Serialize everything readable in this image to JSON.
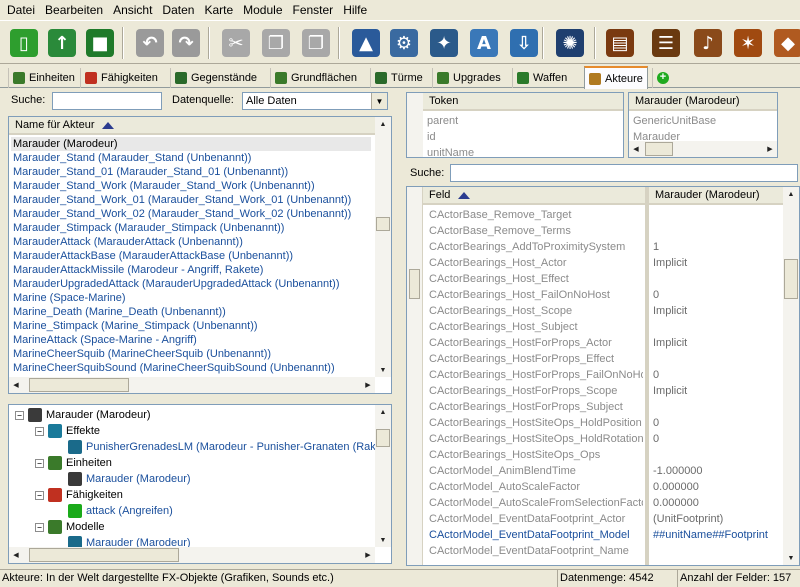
{
  "menu": [
    "Datei",
    "Bearbeiten",
    "Ansicht",
    "Daten",
    "Karte",
    "Module",
    "Fenster",
    "Hilfe"
  ],
  "toolbar": [
    {
      "name": "new-icon",
      "color": "#2e9e2e",
      "glyph": "▯"
    },
    {
      "name": "open-icon",
      "color": "#2a8a3a",
      "glyph": "↑"
    },
    {
      "name": "save-icon",
      "color": "#1f7a2a",
      "glyph": "■"
    },
    {
      "name": "undo-icon",
      "color": "#9a9a9a",
      "glyph": "↶"
    },
    {
      "name": "redo-icon",
      "color": "#9a9a9a",
      "glyph": "↷"
    },
    {
      "name": "cut-icon",
      "color": "#a8a8a8",
      "glyph": "✂"
    },
    {
      "name": "copy-icon",
      "color": "#a8a8a8",
      "glyph": "❐"
    },
    {
      "name": "paste-icon",
      "color": "#a8a8a8",
      "glyph": "❐"
    },
    {
      "name": "terrain-module-icon",
      "color": "#2a5a9a",
      "glyph": "▲"
    },
    {
      "name": "trigger-module-icon",
      "color": "#3a6aa0",
      "glyph": "⚙"
    },
    {
      "name": "data-module-icon",
      "color": "#2b5a8a",
      "glyph": "✦"
    },
    {
      "name": "text-module-icon",
      "color": "#3a78b8",
      "glyph": "A"
    },
    {
      "name": "import-module-icon",
      "color": "#2f6fb0",
      "glyph": "⇩"
    },
    {
      "name": "ai-module-icon",
      "color": "#1f3f6f",
      "glyph": "✺"
    },
    {
      "name": "cutscene-module-icon",
      "color": "#7a3a10",
      "glyph": "▤"
    },
    {
      "name": "list-module-icon",
      "color": "#6a3a10",
      "glyph": "☰"
    },
    {
      "name": "audio-module-icon",
      "color": "#8a4a1a",
      "glyph": "♪"
    },
    {
      "name": "unit-module-icon",
      "color": "#a04a10",
      "glyph": "✶"
    },
    {
      "name": "tech-module-icon",
      "color": "#b05a20",
      "glyph": "◆"
    }
  ],
  "tabs": [
    {
      "label": "Einheiten",
      "icon": "unit-tab-icon",
      "color": "#3a7a2a"
    },
    {
      "label": "Fähigkeiten",
      "icon": "ability-tab-icon",
      "color": "#c03020"
    },
    {
      "label": "Gegenstände",
      "icon": "item-tab-icon",
      "color": "#2a6a2a"
    },
    {
      "label": "Grundflächen",
      "icon": "footprint-tab-icon",
      "color": "#3a7a2a"
    },
    {
      "label": "Türme",
      "icon": "turret-tab-icon",
      "color": "#2a6a2a"
    },
    {
      "label": "Upgrades",
      "icon": "upgrade-tab-icon",
      "color": "#3a7a2a"
    },
    {
      "label": "Waffen",
      "icon": "weapon-tab-icon",
      "color": "#2a7a2a"
    },
    {
      "label": "Akteure",
      "icon": "actor-tab-icon",
      "color": "#b07a20"
    },
    {
      "label": "",
      "icon": "add-tab-icon",
      "color": "#1faa1f"
    }
  ],
  "left": {
    "search_label": "Suche:",
    "search_value": "",
    "source_label": "Datenquelle:",
    "source_value": "Alle Daten",
    "list_header": "Name für Akteur",
    "items": [
      "Marauder (Marodeur)",
      "Marauder_Stand (Marauder_Stand (Unbenannt))",
      "Marauder_Stand_01 (Marauder_Stand_01 (Unbenannt))",
      "Marauder_Stand_Work (Marauder_Stand_Work (Unbenannt))",
      "Marauder_Stand_Work_01 (Marauder_Stand_Work_01 (Unbenannt))",
      "Marauder_Stand_Work_02 (Marauder_Stand_Work_02 (Unbenannt))",
      "Marauder_Stimpack (Marauder_Stimpack (Unbenannt))",
      "MarauderAttack (MarauderAttack (Unbenannt))",
      "MarauderAttackBase (MarauderAttackBase (Unbenannt))",
      "MarauderAttackMissile (Marodeur - Angriff, Rakete)",
      "MarauderUpgradedAttack (MarauderUpgradedAttack (Unbenannt))",
      "Marine (Space-Marine)",
      "Marine_Death (Marine_Death (Unbenannt))",
      "Marine_Stimpack (Marine_Stimpack (Unbenannt))",
      "MarineAttack (Space-Marine - Angriff)",
      "MarineCheerSquib (MarineCheerSquib (Unbenannt))",
      "MarineCheerSquibSound (MarineCheerSquibSound (Unbenannt))"
    ],
    "tree": [
      {
        "level": 0,
        "exp": "−",
        "icon": "marauder-icon",
        "color": "#3a3a3a",
        "text": "Marauder (Marodeur)",
        "blue": false
      },
      {
        "level": 1,
        "exp": "−",
        "icon": "effects-folder-icon",
        "color": "#1a7a9a",
        "text": "Effekte",
        "blue": false
      },
      {
        "level": 2,
        "exp": "",
        "icon": "punisher-grenade-icon",
        "color": "#1a6a8a",
        "text": "PunisherGrenadesLM (Marodeur - Punisher-Granaten (Rakete))",
        "blue": true
      },
      {
        "level": 1,
        "exp": "−",
        "icon": "units-folder-icon",
        "color": "#3a7a2a",
        "text": "Einheiten",
        "blue": false
      },
      {
        "level": 2,
        "exp": "",
        "icon": "marauder-unit-icon",
        "color": "#3a3a3a",
        "text": "Marauder (Marodeur)",
        "blue": true
      },
      {
        "level": 1,
        "exp": "−",
        "icon": "abilities-folder-icon",
        "color": "#c03020",
        "text": "Fähigkeiten",
        "blue": false
      },
      {
        "level": 2,
        "exp": "",
        "icon": "attack-ability-icon",
        "color": "#1aaa1a",
        "text": "attack (Angreifen)",
        "blue": true
      },
      {
        "level": 1,
        "exp": "−",
        "icon": "models-folder-icon",
        "color": "#3a7a2a",
        "text": "Modelle",
        "blue": false
      },
      {
        "level": 2,
        "exp": "",
        "icon": "marauder-model-icon",
        "color": "#1a6a8a",
        "text": "Marauder (Marodeur)",
        "blue": true
      }
    ]
  },
  "right": {
    "token_header": "Token",
    "tokens": [
      "parent",
      "id",
      "unitName"
    ],
    "value_header": "Marauder (Marodeur)",
    "token_values": [
      "GenericUnitBase",
      "Marauder",
      ""
    ],
    "search_label": "Suche:",
    "search_value": "",
    "field_header": "Feld",
    "col_header": "Marauder (Marodeur)",
    "fields": [
      {
        "name": "CActorBase_Remove_Target",
        "value": ""
      },
      {
        "name": "CActorBase_Remove_Terms",
        "value": ""
      },
      {
        "name": "CActorBearings_AddToProximitySystem",
        "value": "1"
      },
      {
        "name": "CActorBearings_Host_Actor",
        "value": "Implicit"
      },
      {
        "name": "CActorBearings_Host_Effect",
        "value": ""
      },
      {
        "name": "CActorBearings_Host_FailOnNoHost",
        "value": "0"
      },
      {
        "name": "CActorBearings_Host_Scope",
        "value": "Implicit"
      },
      {
        "name": "CActorBearings_Host_Subject",
        "value": ""
      },
      {
        "name": "CActorBearings_HostForProps_Actor",
        "value": "Implicit"
      },
      {
        "name": "CActorBearings_HostForProps_Effect",
        "value": ""
      },
      {
        "name": "CActorBearings_HostForProps_FailOnNoHost",
        "value": "0"
      },
      {
        "name": "CActorBearings_HostForProps_Scope",
        "value": "Implicit"
      },
      {
        "name": "CActorBearings_HostForProps_Subject",
        "value": ""
      },
      {
        "name": "CActorBearings_HostSiteOps_HoldPosition",
        "value": "0"
      },
      {
        "name": "CActorBearings_HostSiteOps_HoldRotation",
        "value": "0"
      },
      {
        "name": "CActorBearings_HostSiteOps_Ops",
        "value": ""
      },
      {
        "name": "CActorModel_AnimBlendTime",
        "value": "-1.000000"
      },
      {
        "name": "CActorModel_AutoScaleFactor",
        "value": "0.000000"
      },
      {
        "name": "CActorModel_AutoScaleFromSelectionFactor",
        "value": "0.000000"
      },
      {
        "name": "CActorModel_EventDataFootprint_Actor",
        "value": "(UnitFootprint)"
      },
      {
        "name": "CActorModel_EventDataFootprint_Model",
        "value": "##unitName##Footprint"
      },
      {
        "name": "CActorModel_EventDataFootprint_Name",
        "value": ""
      }
    ]
  },
  "status": {
    "left": "Akteure: In der Welt dargestellte FX-Objekte (Grafiken, Sounds etc.)",
    "count": "Datenmenge: 4542",
    "fields": "Anzahl der Felder: 157"
  }
}
